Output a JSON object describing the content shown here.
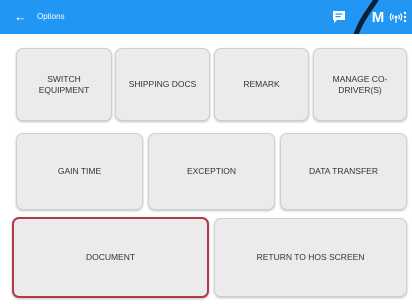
{
  "app_bar": {
    "back_glyph": "←",
    "title": "Options",
    "m_label": "M",
    "color": "#2196f3",
    "icons": [
      "message-icon",
      "m-icon",
      "wifi-signal-icon",
      "more-options-icon"
    ]
  },
  "buttons": {
    "switch_equipment": "SWITCH EQUIPMENT",
    "shipping_docs": "SHIPPING DOCS",
    "remark": "REMARK",
    "manage_co_driver": "MANAGE CO-DRIVER(S)",
    "gain_time": "GAIN TIME",
    "exception": "EXCEPTION",
    "data_transfer": "DATA TRANSFER",
    "document": "DOCUMENT",
    "return_to_hos": "RETURN TO HOS SCREEN"
  },
  "highlight_color": "#b23a48",
  "button_color": "#ebebeb"
}
